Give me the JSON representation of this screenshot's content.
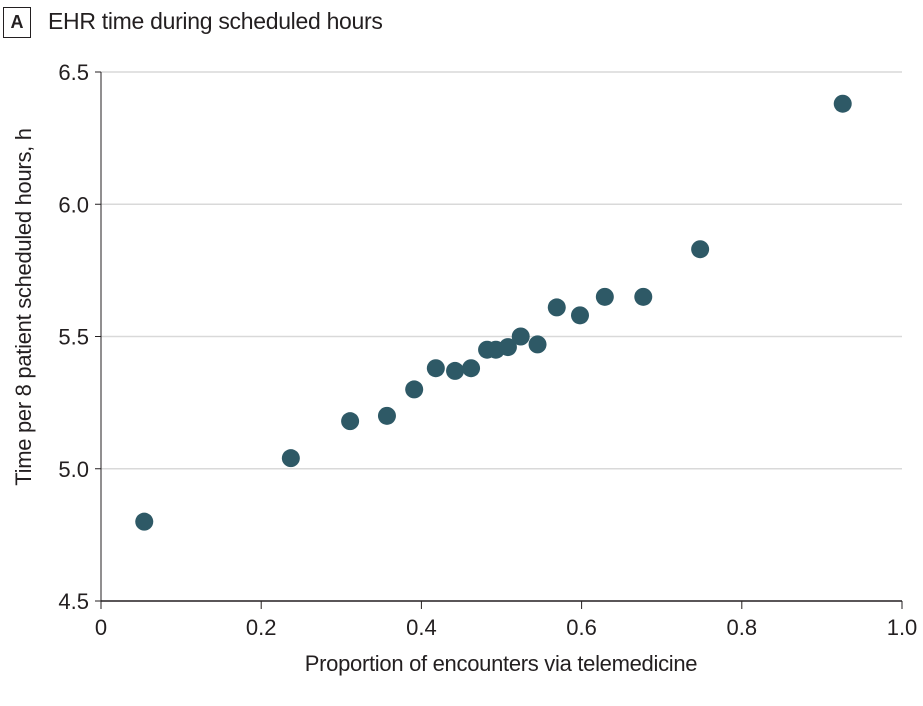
{
  "panel_label": "A",
  "chart_data": {
    "type": "scatter",
    "title": "EHR time during scheduled hours",
    "xlabel": "Proportion of encounters via telemedicine",
    "ylabel": "Time per 8 patient scheduled hours, h",
    "xlim": [
      0,
      1.0
    ],
    "ylim": [
      4.5,
      6.5
    ],
    "xticks": [
      0,
      0.2,
      0.4,
      0.6,
      0.8,
      1.0
    ],
    "xtick_labels": [
      "0",
      "0.2",
      "0.4",
      "0.6",
      "0.8",
      "1.0"
    ],
    "yticks": [
      4.5,
      5.0,
      5.5,
      6.0,
      6.5
    ],
    "ytick_labels": [
      "4.5",
      "5.0",
      "5.5",
      "6.0",
      "6.5"
    ],
    "grid": "horizontal",
    "marker_color": "#2e5966",
    "grid_color": "#d9d9d9",
    "points": [
      {
        "x": 0.054,
        "y": 4.8
      },
      {
        "x": 0.237,
        "y": 5.04
      },
      {
        "x": 0.311,
        "y": 5.18
      },
      {
        "x": 0.357,
        "y": 5.2
      },
      {
        "x": 0.391,
        "y": 5.3
      },
      {
        "x": 0.418,
        "y": 5.38
      },
      {
        "x": 0.442,
        "y": 5.37
      },
      {
        "x": 0.462,
        "y": 5.38
      },
      {
        "x": 0.482,
        "y": 5.45
      },
      {
        "x": 0.493,
        "y": 5.45
      },
      {
        "x": 0.508,
        "y": 5.46
      },
      {
        "x": 0.524,
        "y": 5.5
      },
      {
        "x": 0.545,
        "y": 5.47
      },
      {
        "x": 0.569,
        "y": 5.61
      },
      {
        "x": 0.598,
        "y": 5.58
      },
      {
        "x": 0.629,
        "y": 5.65
      },
      {
        "x": 0.677,
        "y": 5.65
      },
      {
        "x": 0.748,
        "y": 5.83
      },
      {
        "x": 0.926,
        "y": 6.38
      }
    ]
  }
}
